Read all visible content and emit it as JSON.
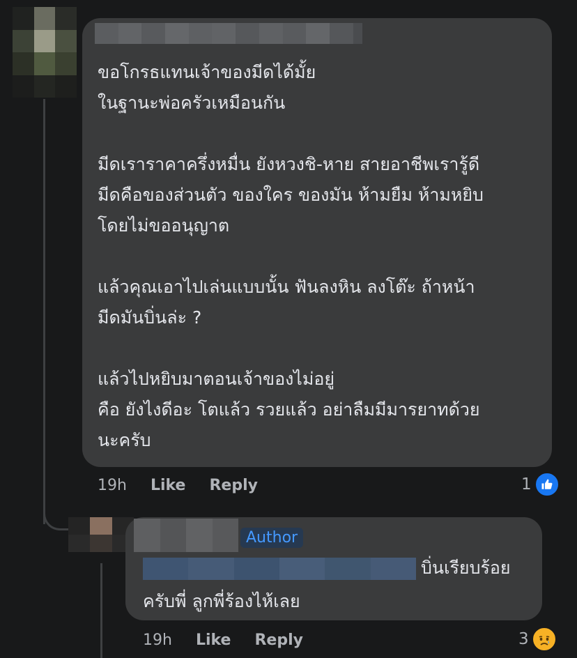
{
  "comment": {
    "text_lines": [
      "ขอโกรธแทนเจ้าของมีดได้มั้ย",
      "ในฐานะพ่อครัวเหมือนกัน",
      "",
      "มีดเราราคาครึ่งหมื่น ยังหวงชิ-หาย สายอาชีพเรารู้ดี",
      "มีดคือของส่วนตัว ของใคร ของมัน ห้ามยืม ห้ามหยิบ",
      "โดยไม่ขออนุญาต",
      "",
      "แล้วคุณเอาไปเล่นแบบนั้น ฟันลงหิน ลงโต๊ะ ถ้าหน้า",
      "มีดมันบิ่นล่ะ ?",
      "",
      "แล้วไปหยิบมาตอนเจ้าของไม่อยู่",
      "คือ ยังไงดีอะ โตแล้ว รวยแล้ว อย่าลืมมีมารยาทด้วย",
      "นะครับ"
    ],
    "time": "19h",
    "like_label": "Like",
    "reply_label": "Reply",
    "reaction_count": "1",
    "reaction_icon": "like-icon"
  },
  "reply": {
    "author_badge": "Author",
    "text_line1": "บิ่นเรียบร้อย",
    "text_line2": "ครับพี่ ลูกพี่ร้องไห้เลย",
    "time": "19h",
    "like_label": "Like",
    "reply_label": "Reply",
    "reaction_count": "3",
    "reaction_icon": "sad-face-icon"
  },
  "colors": {
    "background": "#18191a",
    "bubble": "#3a3b3c",
    "text": "#e4e6eb",
    "meta_text": "#b0b3b8",
    "author_badge_bg": "#263951",
    "author_badge_text": "#4599ff",
    "like_blue": "#1877f2"
  }
}
